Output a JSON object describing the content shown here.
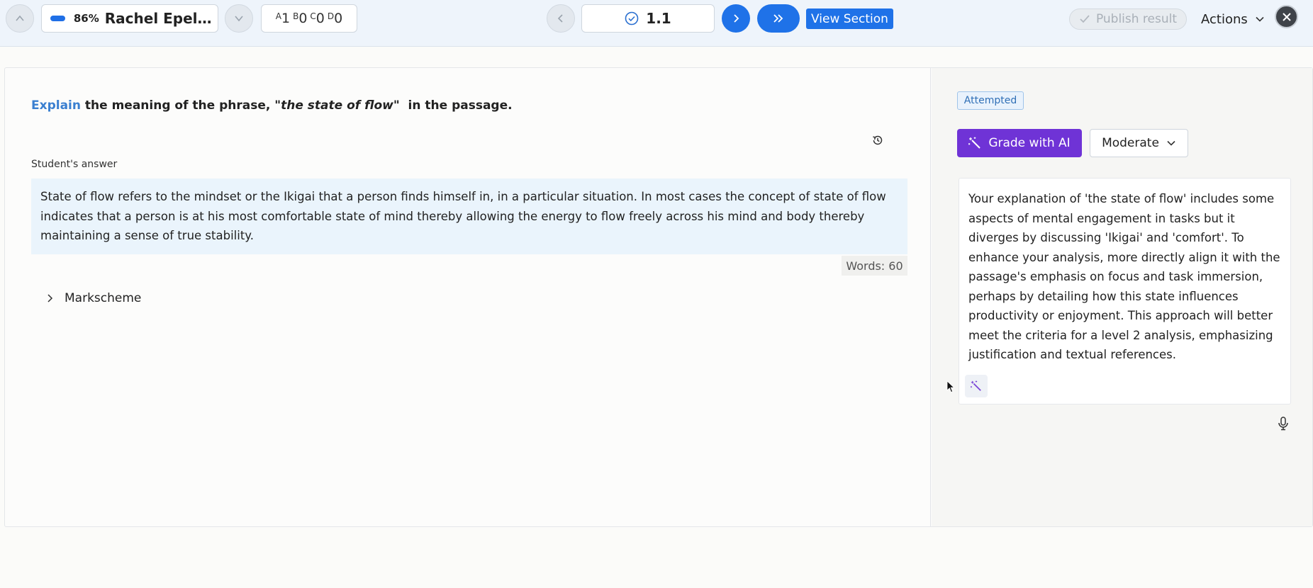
{
  "topbar": {
    "student_progress_pct": "86%",
    "student_name": "Rachel Epelbau...",
    "grades": [
      {
        "letter": "A",
        "count": "1"
      },
      {
        "letter": "B",
        "count": "0"
      },
      {
        "letter": "C",
        "count": "0"
      },
      {
        "letter": "D",
        "count": "0"
      }
    ],
    "question_number": "1.1",
    "view_section_label": "View Section",
    "publish_label": "Publish result",
    "actions_label": "Actions"
  },
  "question": {
    "keyword": "Explain",
    "text_before": " the meaning of the phrase, ",
    "phrase": "\"the state of flow\"",
    "text_after": "  in the passage."
  },
  "answer": {
    "label": "Student's answer",
    "text": "State of flow refers to the mindset or the Ikigai that a person finds himself in, in a particular situation. In most cases the concept of state of flow indicates that a person is at his most comfortable state of mind thereby allowing the energy to flow freely across his mind and body thereby maintaining a sense of true stability.",
    "word_count": "Words: 60"
  },
  "markscheme_label": "Markscheme",
  "grading": {
    "status": "Attempted",
    "grade_ai_label": "Grade with AI",
    "moderate_label": "Moderate",
    "feedback": "Your explanation of 'the state of flow' includes some aspects of mental engagement in tasks but it diverges by discussing 'Ikigai' and 'comfort'. To enhance your analysis, more directly align it with the passage's emphasis on focus and task immersion, perhaps by detailing how this state influences productivity or enjoyment. This approach will better meet the criteria for a level 2 analysis, emphasizing justification and textual references."
  },
  "colors": {
    "primary": "#1f72e8",
    "ai_purple": "#6f33d6",
    "keyword_blue": "#3a7fd0",
    "answer_bg": "#eaf4fc"
  }
}
